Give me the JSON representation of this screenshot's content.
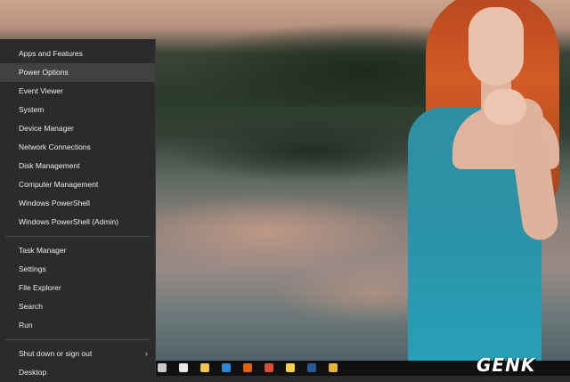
{
  "menu": {
    "group1": [
      {
        "label": "Apps and Features",
        "name": "menu-apps-and-features"
      },
      {
        "label": "Power Options",
        "name": "menu-power-options",
        "highlighted": true
      },
      {
        "label": "Event Viewer",
        "name": "menu-event-viewer"
      },
      {
        "label": "System",
        "name": "menu-system"
      },
      {
        "label": "Device Manager",
        "name": "menu-device-manager"
      },
      {
        "label": "Network Connections",
        "name": "menu-network-connections"
      },
      {
        "label": "Disk Management",
        "name": "menu-disk-management"
      },
      {
        "label": "Computer Management",
        "name": "menu-computer-management"
      },
      {
        "label": "Windows PowerShell",
        "name": "menu-windows-powershell"
      },
      {
        "label": "Windows PowerShell (Admin)",
        "name": "menu-windows-powershell-admin"
      }
    ],
    "group2": [
      {
        "label": "Task Manager",
        "name": "menu-task-manager"
      },
      {
        "label": "Settings",
        "name": "menu-settings"
      },
      {
        "label": "File Explorer",
        "name": "menu-file-explorer"
      },
      {
        "label": "Search",
        "name": "menu-search"
      },
      {
        "label": "Run",
        "name": "menu-run"
      }
    ],
    "group3": [
      {
        "label": "Shut down or sign out",
        "name": "menu-shut-down-or-sign-out",
        "submenu": true
      },
      {
        "label": "Desktop",
        "name": "menu-desktop"
      }
    ],
    "submenu_glyph": "›"
  },
  "taskbar": {
    "icons": [
      {
        "name": "store-icon",
        "color": "#c9c9c9"
      },
      {
        "name": "mail-icon",
        "color": "#e8e8e8"
      },
      {
        "name": "file-explorer-icon",
        "color": "#f2c14e"
      },
      {
        "name": "photos-icon",
        "color": "#2f86d6"
      },
      {
        "name": "firefox-icon",
        "color": "#e66000"
      },
      {
        "name": "chrome-icon",
        "color": "#dd4b39"
      },
      {
        "name": "sticky-notes-icon",
        "color": "#f5d04a"
      },
      {
        "name": "word-icon",
        "color": "#2b5797"
      },
      {
        "name": "chrome-canary-icon",
        "color": "#e8b339"
      }
    ]
  },
  "watermark": {
    "text": "GENK"
  }
}
